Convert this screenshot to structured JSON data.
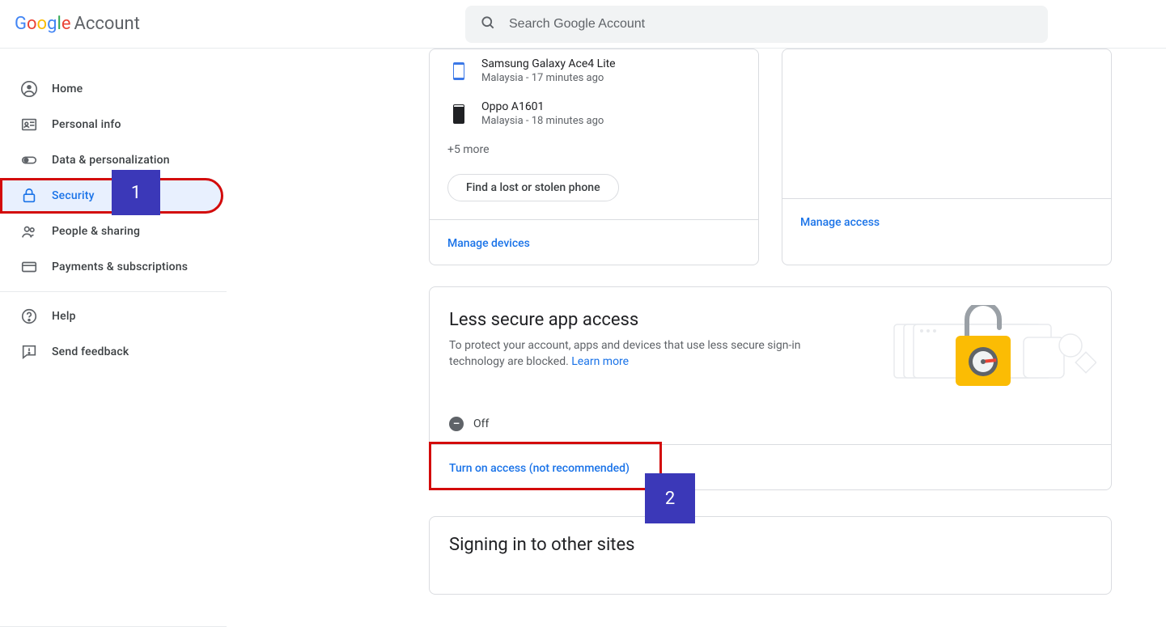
{
  "header": {
    "brand_account": "Account",
    "search_placeholder": "Search Google Account"
  },
  "sidebar": {
    "items": [
      {
        "label": "Home"
      },
      {
        "label": "Personal info"
      },
      {
        "label": "Data & personalization"
      },
      {
        "label": "Security"
      },
      {
        "label": "People & sharing"
      },
      {
        "label": "Payments & subscriptions"
      }
    ],
    "help": "Help",
    "feedback": "Send feedback"
  },
  "annotations": {
    "callout1": "1",
    "callout2": "2"
  },
  "devices_card": {
    "items": [
      {
        "name": "Samsung Galaxy Ace4 Lite",
        "meta": "Malaysia - 17 minutes ago"
      },
      {
        "name": "Oppo A1601",
        "meta": "Malaysia - 18 minutes ago"
      }
    ],
    "more": "+5 more",
    "find_phone": "Find a lost or stolen phone",
    "manage": "Manage devices"
  },
  "access_card": {
    "manage": "Manage access"
  },
  "less_secure": {
    "title": "Less secure app access",
    "desc": "To protect your account, apps and devices that use less secure sign-in technology are blocked. ",
    "learn_more": "Learn more",
    "status": "Off",
    "turn_on": "Turn on access (not recommended)"
  },
  "signing": {
    "title": "Signing in to other sites"
  }
}
